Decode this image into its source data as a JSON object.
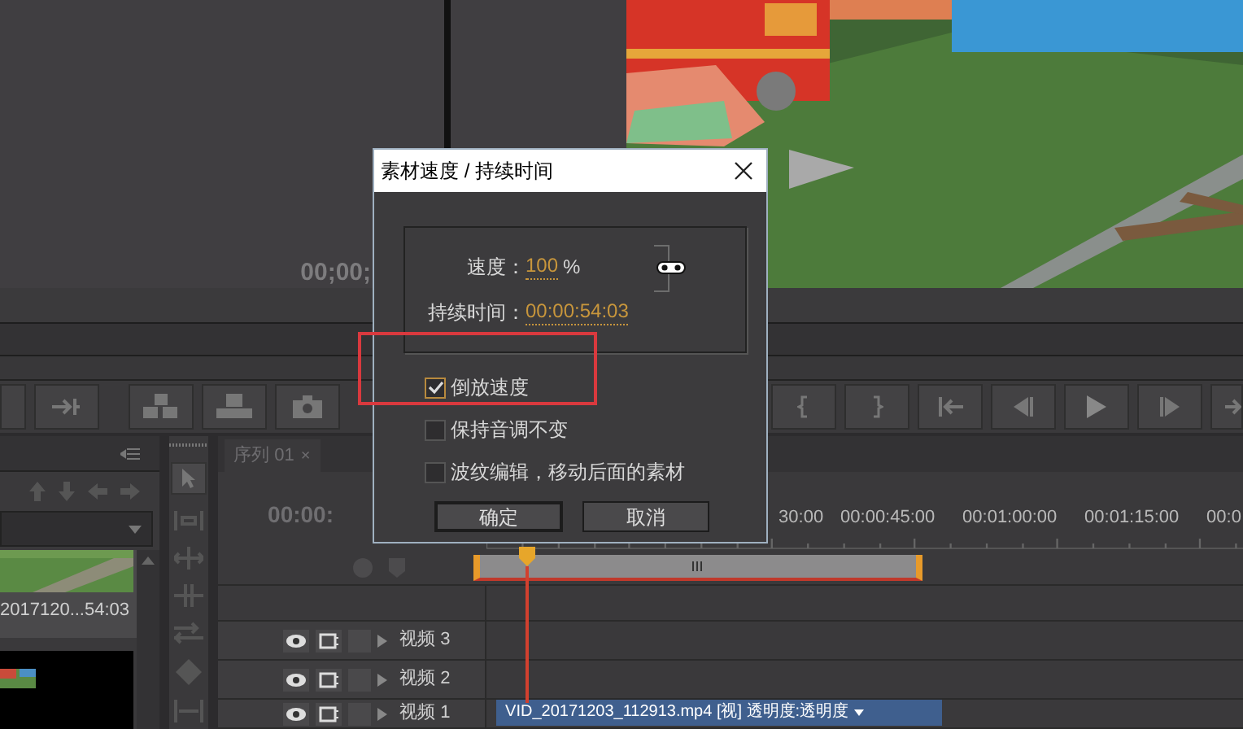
{
  "source_monitor": {
    "timecode": "00;00;"
  },
  "project_panel": {
    "clip": {
      "name": "2017120...",
      "duration": "54:03"
    }
  },
  "timeline": {
    "tab": {
      "label": "序列 01",
      "close": "×"
    },
    "timecode": "00:00:",
    "ruler": [
      "30:00",
      "00:00:45:00",
      "00:01:00:00",
      "00:01:15:00",
      "00:0"
    ],
    "tracks": [
      {
        "name": "视频 3"
      },
      {
        "name": "视频 2"
      },
      {
        "name": "视频 1",
        "clip": "VID_20171203_112913.mp4 [视] 透明度:透明度"
      }
    ]
  },
  "dialog": {
    "title": "素材速度 / 持续时间",
    "speed_label": "速度：",
    "speed": "100",
    "speed_unit": "%",
    "duration_label": "持续时间：",
    "duration": "00:00:54:03",
    "options": [
      {
        "label": "倒放速度",
        "checked": true
      },
      {
        "label": "保持音调不变",
        "checked": false
      },
      {
        "label": "波纹编辑，移动后面的素材",
        "checked": false
      }
    ],
    "buttons": [
      "确定",
      "取消"
    ]
  }
}
